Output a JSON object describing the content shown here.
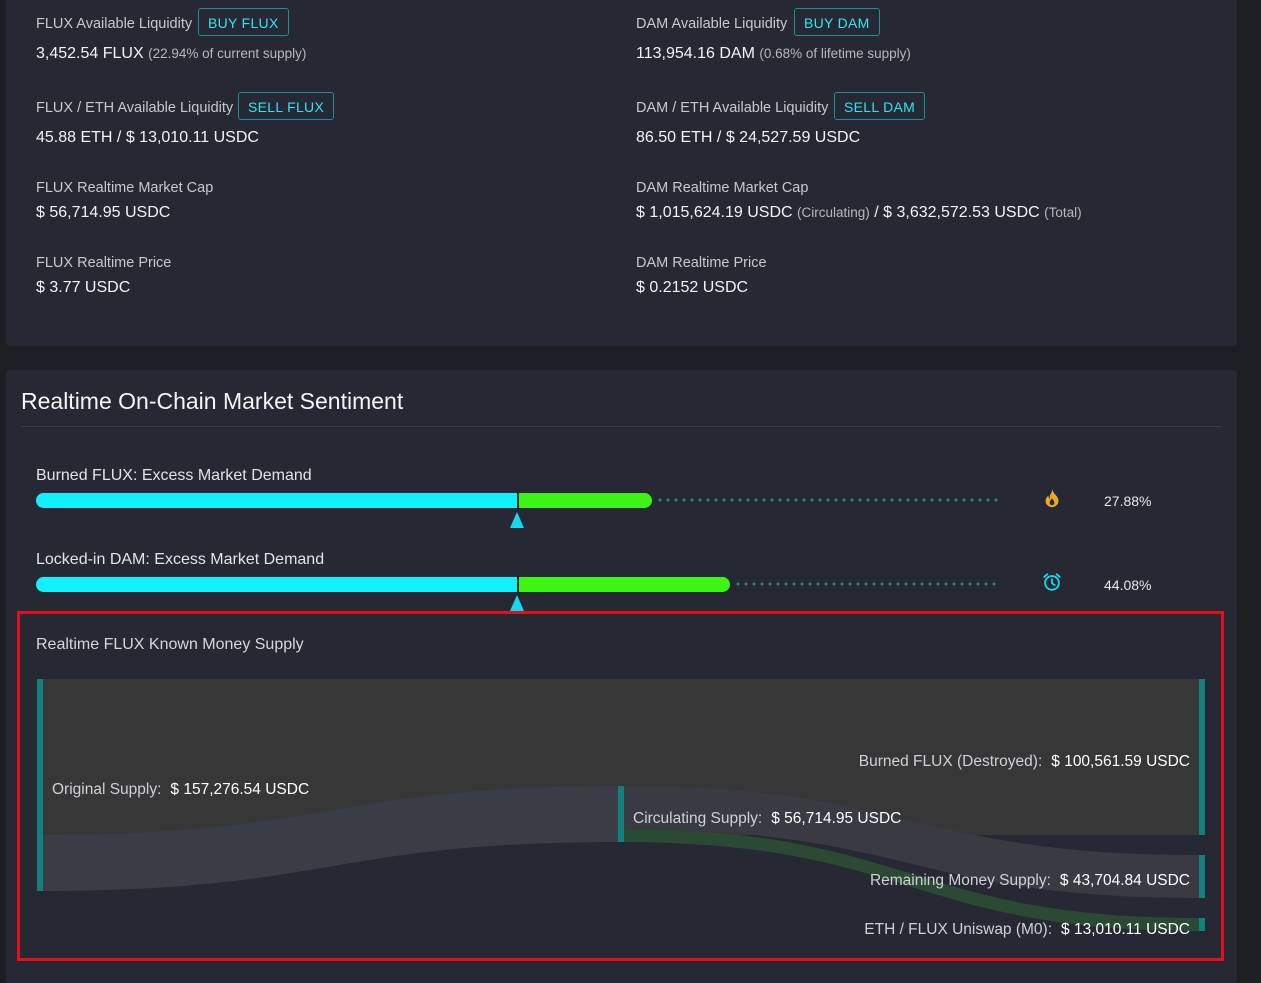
{
  "liquidity": {
    "flux": {
      "label": "FLUX Available Liquidity",
      "button": "BUY FLUX",
      "value": "3,452.54 FLUX",
      "note": "(22.94% of current supply)"
    },
    "dam": {
      "label": "DAM Available Liquidity",
      "button": "BUY DAM",
      "value": "113,954.16 DAM",
      "note": "(0.68% of lifetime supply)"
    },
    "flux_eth": {
      "label": "FLUX / ETH Available Liquidity",
      "button": "SELL FLUX",
      "value": "45.88 ETH / $ 13,010.11 USDC"
    },
    "dam_eth": {
      "label": "DAM / ETH Available Liquidity",
      "button": "SELL DAM",
      "value": "86.50 ETH / $ 24,527.59 USDC"
    }
  },
  "market": {
    "flux_cap": {
      "label": "FLUX Realtime Market Cap",
      "value": "$ 56,714.95 USDC"
    },
    "dam_cap": {
      "label": "DAM Realtime Market Cap",
      "circulating_value": "$ 1,015,624.19 USDC",
      "circulating_note": "(Circulating)",
      "separator": "/",
      "total_value": "$ 3,632,572.53 USDC",
      "total_note": "(Total)"
    },
    "flux_price": {
      "label": "FLUX Realtime Price",
      "value": "$ 3.77 USDC"
    },
    "dam_price": {
      "label": "DAM Realtime Price",
      "value": "$ 0.2152 USDC"
    }
  },
  "sentiment": {
    "title": "Realtime On-Chain Market Sentiment",
    "gauges": [
      {
        "label": "Burned FLUX: Excess Market Demand",
        "percent": "27.88%",
        "fill": 0.2788,
        "icon": "flame-icon",
        "icon_color": "#f5a623"
      },
      {
        "label": "Locked-in DAM: Excess Market Demand",
        "percent": "44.08%",
        "fill": 0.4408,
        "icon": "alarm-clock-icon",
        "icon_color": "#19d7ea"
      }
    ]
  },
  "supply": {
    "title": "Realtime FLUX Known Money Supply",
    "nodes": {
      "original": {
        "name": "Original Supply:",
        "value": "$ 157,276.54 USDC"
      },
      "circulating": {
        "name": "Circulating Supply:",
        "value": "$ 56,714.95 USDC"
      },
      "burned": {
        "name": "Burned FLUX (Destroyed):",
        "value": "$ 100,561.59 USDC"
      },
      "remaining": {
        "name": "Remaining Money Supply:",
        "value": "$ 43,704.84 USDC"
      },
      "uniswap": {
        "name": "ETH / FLUX Uniswap (M0):",
        "value": "$ 13,010.11 USDC"
      }
    }
  },
  "colors": {
    "accent": "#2ee6f2",
    "bar_primary": "#10f0ff",
    "bar_excess": "#3df514",
    "node": "#137f7f",
    "highlight": "#e3101c"
  }
}
